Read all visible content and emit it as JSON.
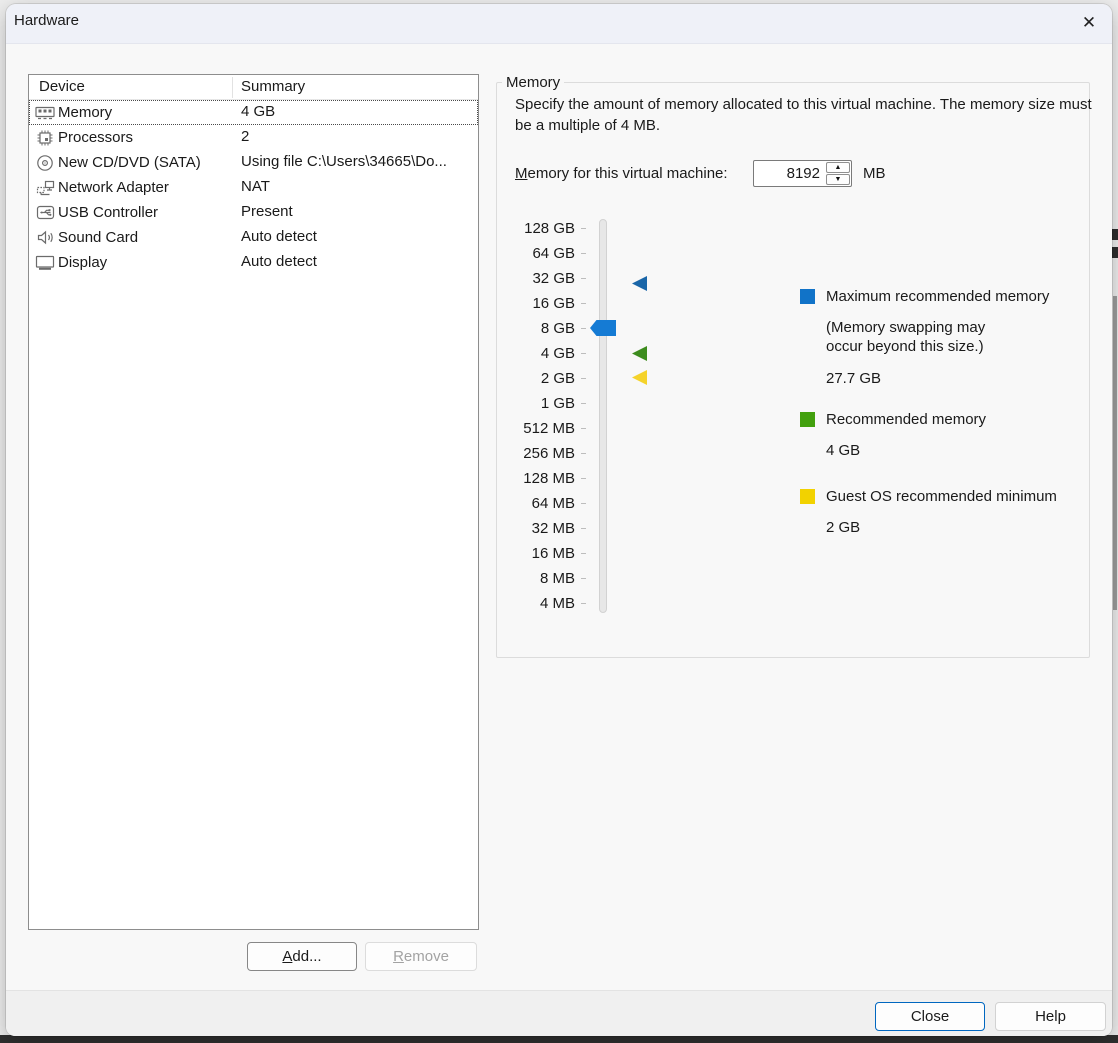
{
  "window": {
    "title": "Hardware",
    "close_glyph": "✕"
  },
  "device_table": {
    "columns": [
      "Device",
      "Summary"
    ],
    "rows": [
      {
        "name": "Memory",
        "summary": "4 GB"
      },
      {
        "name": "Processors",
        "summary": "2"
      },
      {
        "name": "New CD/DVD (SATA)",
        "summary": "Using file C:\\Users\\34665\\Do..."
      },
      {
        "name": "Network Adapter",
        "summary": "NAT"
      },
      {
        "name": "USB Controller",
        "summary": "Present"
      },
      {
        "name": "Sound Card",
        "summary": "Auto detect"
      },
      {
        "name": "Display",
        "summary": "Auto detect"
      }
    ]
  },
  "buttons": {
    "add": "Add...",
    "remove": "Remove",
    "close": "Close",
    "help": "Help"
  },
  "memory_panel": {
    "group_title": "Memory",
    "description": "Specify the amount of memory allocated to this virtual machine. The memory size must be a multiple of 4 MB.",
    "field_label": "Memory for this virtual machine:",
    "value": "8192",
    "unit": "MB",
    "spin_up_glyph": "▲",
    "spin_down_glyph": "▼",
    "slider": {
      "ticks": [
        "128 GB",
        "64 GB",
        "32 GB",
        "16 GB",
        "8 GB",
        "4 GB",
        "2 GB",
        "1 GB",
        "512 MB",
        "256 MB",
        "128 MB",
        "64 MB",
        "32 MB",
        "16 MB",
        "8 MB",
        "4 MB"
      ],
      "handle": {
        "color": "#157bd4",
        "value": "8 GB"
      },
      "markers": [
        {
          "name": "maximum-recommended",
          "color": "#1a66a8",
          "at": "27.7 GB"
        },
        {
          "name": "recommended",
          "color": "#3d8c1e",
          "at": "4 GB"
        },
        {
          "name": "guest-os-minimum",
          "color": "#f5d32b",
          "at": "2 GB"
        }
      ]
    },
    "legend": [
      {
        "color": "#1173c8",
        "label": "Maximum recommended memory",
        "note": "(Memory swapping may occur beyond this size.)",
        "value": "27.7 GB"
      },
      {
        "color": "#42a00e",
        "label": "Recommended memory",
        "value": "4 GB"
      },
      {
        "color": "#f2d200",
        "label": "Guest OS recommended minimum",
        "value": "2 GB"
      }
    ]
  }
}
